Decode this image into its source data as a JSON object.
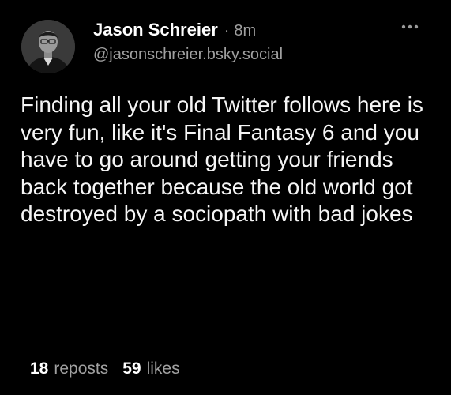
{
  "post": {
    "author": {
      "display_name": "Jason Schreier",
      "separator": "·",
      "time": "8m",
      "handle": "@jasonschreier.bsky.social",
      "avatar_icon": "user-avatar-photo"
    },
    "more_icon": "ellipsis-icon",
    "text": "Finding all your old Twitter follows here is very fun, like it's Final Fantasy 6 and you have to go around getting your friends back together because the old world got destroyed by a sociopath with bad jokes",
    "stats": {
      "reposts_count": "18",
      "reposts_label": "reposts",
      "likes_count": "59",
      "likes_label": "likes"
    }
  },
  "colors": {
    "background": "#000000",
    "primary_text": "#ffffff",
    "secondary_text": "#a0a0a0",
    "divider": "#2a2a2a"
  }
}
